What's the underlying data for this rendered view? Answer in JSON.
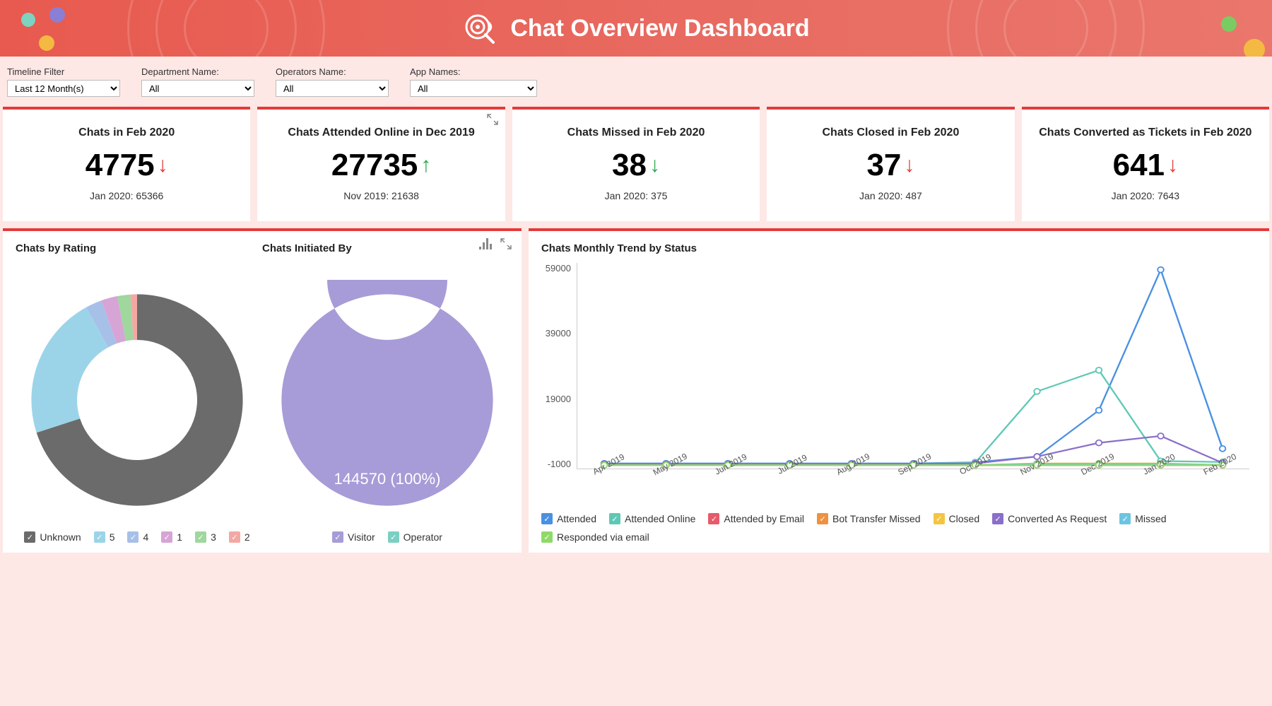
{
  "header": {
    "title": "Chat Overview Dashboard"
  },
  "filters": {
    "timeline": {
      "label": "Timeline Filter",
      "value": "Last 12 Month(s)"
    },
    "department": {
      "label": "Department Name:",
      "value": "All"
    },
    "operators": {
      "label": "Operators Name:",
      "value": "All"
    },
    "apps": {
      "label": "App Names:",
      "value": "All"
    }
  },
  "kpis": [
    {
      "title": "Chats in Feb 2020",
      "value": "4775",
      "trend": "down-red",
      "sub": "Jan 2020: 65366"
    },
    {
      "title": "Chats Attended Online in Dec 2019",
      "value": "27735",
      "trend": "up-green",
      "sub": "Nov 2019: 21638"
    },
    {
      "title": "Chats Missed in Feb 2020",
      "value": "38",
      "trend": "down-green",
      "sub": "Jan 2020: 375"
    },
    {
      "title": "Chats Closed in Feb 2020",
      "value": "37",
      "trend": "down-red",
      "sub": "Jan 2020: 487"
    },
    {
      "title": "Chats Converted as Tickets in Feb 2020",
      "value": "641",
      "trend": "down-red",
      "sub": "Jan 2020: 7643"
    }
  ],
  "panels": {
    "rating_title": "Chats by Rating",
    "initiated_title": "Chats Initiated By",
    "trend_title": "Chats Monthly Trend by Status",
    "initiated_center_label": "144570 (100%)"
  },
  "legend_rating": [
    "Unknown",
    "5",
    "4",
    "1",
    "3",
    "2"
  ],
  "legend_initiated": [
    "Visitor",
    "Operator"
  ],
  "legend_trend": [
    "Attended",
    "Attended Online",
    "Attended by Email",
    "Bot Transfer Missed",
    "Closed",
    "Converted As Request",
    "Missed",
    "Responded via email"
  ],
  "colors": {
    "unknown": "#6b6b6b",
    "r5": "#9bd4e8",
    "r4": "#a7c0e8",
    "r1": "#d7a4d6",
    "r3": "#9fd79f",
    "r2": "#f3a8a3",
    "visitor": "#a79cd7",
    "operator": "#7bcfc3",
    "attended": "#4a90e2",
    "attended_online": "#5ec8b5",
    "attended_email": "#e65a6a",
    "bot": "#f0913f",
    "closed": "#f4c542",
    "converted": "#8a6fc9",
    "missed": "#6cc5e0",
    "responded": "#8fd968"
  },
  "chart_data": [
    {
      "id": "chats_by_rating",
      "type": "pie",
      "title": "Chats by Rating",
      "series": [
        {
          "name": "Unknown",
          "value": 70,
          "color": "#6b6b6b"
        },
        {
          "name": "5",
          "value": 22,
          "color": "#9bd4e8"
        },
        {
          "name": "4",
          "value": 2.5,
          "color": "#a7c0e8"
        },
        {
          "name": "1",
          "value": 2.5,
          "color": "#d7a4d6"
        },
        {
          "name": "3",
          "value": 2,
          "color": "#9fd79f"
        },
        {
          "name": "2",
          "value": 1,
          "color": "#f3a8a3"
        }
      ]
    },
    {
      "id": "chats_initiated_by",
      "type": "pie",
      "title": "Chats Initiated By",
      "total_label": "144570 (100%)",
      "series": [
        {
          "name": "Visitor",
          "value": 100,
          "color": "#a79cd7"
        },
        {
          "name": "Operator",
          "value": 0,
          "color": "#7bcfc3"
        }
      ]
    },
    {
      "id": "chats_monthly_trend",
      "type": "line",
      "title": "Chats Monthly Trend by Status",
      "xlabel": "",
      "ylabel": "",
      "ylim": [
        -1000,
        59000
      ],
      "categories": [
        "Apr 2019",
        "May 2019",
        "Jun 2019",
        "Jul 2019",
        "Aug 2019",
        "Sep 2019",
        "Oct 2019",
        "Nov 2019",
        "Dec 2019",
        "Jan 2020",
        "Feb 2020"
      ],
      "series": [
        {
          "name": "Attended",
          "color": "#4a90e2",
          "values": [
            500,
            500,
            500,
            500,
            500,
            500,
            800,
            2500,
            16000,
            57000,
            4800
          ]
        },
        {
          "name": "Attended Online",
          "color": "#5ec8b5",
          "values": [
            400,
            400,
            400,
            400,
            400,
            400,
            700,
            21500,
            27700,
            1200,
            900
          ]
        },
        {
          "name": "Attended by Email",
          "color": "#e65a6a",
          "values": [
            0,
            0,
            0,
            0,
            0,
            0,
            0,
            0,
            0,
            0,
            0
          ]
        },
        {
          "name": "Bot Transfer Missed",
          "color": "#f0913f",
          "values": [
            0,
            0,
            0,
            0,
            0,
            0,
            0,
            0,
            0,
            0,
            0
          ]
        },
        {
          "name": "Closed",
          "color": "#f4c542",
          "values": [
            0,
            0,
            0,
            0,
            0,
            0,
            0,
            500,
            500,
            500,
            40
          ]
        },
        {
          "name": "Converted As Request",
          "color": "#8a6fc9",
          "values": [
            400,
            400,
            400,
            400,
            400,
            400,
            500,
            2500,
            6500,
            8500,
            640
          ]
        },
        {
          "name": "Missed",
          "color": "#6cc5e0",
          "values": [
            0,
            0,
            0,
            0,
            0,
            0,
            0,
            400,
            400,
            400,
            40
          ]
        },
        {
          "name": "Responded via email",
          "color": "#8fd968",
          "values": [
            0,
            0,
            0,
            0,
            0,
            0,
            0,
            0,
            0,
            0,
            0
          ]
        }
      ]
    }
  ]
}
